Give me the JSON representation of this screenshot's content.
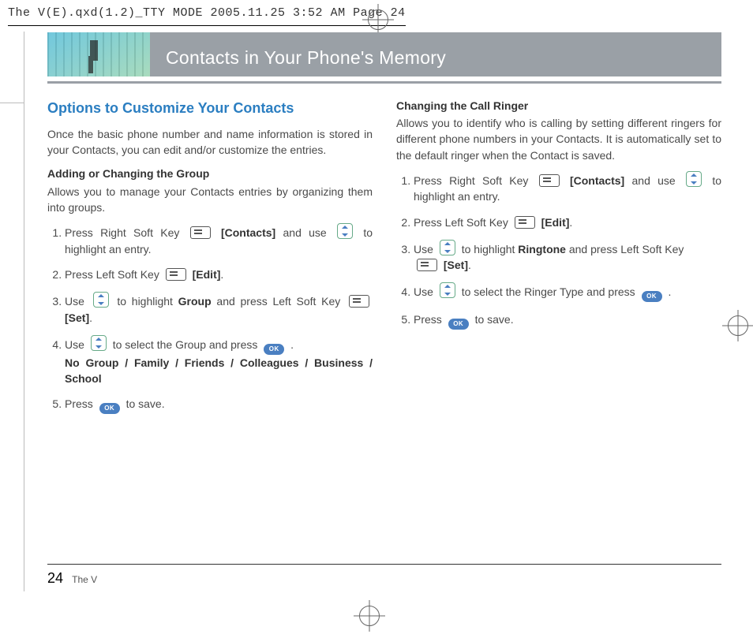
{
  "slug": "The V(E).qxd(1.2)_TTY MODE  2005.11.25  3:52 AM  Page 24",
  "header": {
    "title": "Contacts in Your Phone's Memory"
  },
  "left": {
    "section_title": "Options to Customize Your Contacts",
    "intro": "Once the basic phone number and name information is stored in your Contacts, you can edit and/or customize the entries.",
    "sub1_title": "Adding or Changing the Group",
    "sub1_lead": "Allows you to manage your Contacts entries by organizing them into groups.",
    "s1_a": "Press Right Soft Key",
    "s1_b": "[Contacts]",
    "s1_c": "and use",
    "s1_d": "to highlight an entry.",
    "s2_a": "Press Left Soft Key",
    "s2_b": "[Edit]",
    "s3_a": "Use",
    "s3_b": "to highlight",
    "s3_c": "Group",
    "s3_d": "and press Left Soft Key",
    "s3_e": "[Set]",
    "s4_a": "Use",
    "s4_b": "to select the Group and press",
    "s4_groups": "No Group / Family / Friends / Colleagues / Business / School",
    "s5_a": "Press",
    "s5_b": "to save."
  },
  "right": {
    "sub_title": "Changing the Call Ringer",
    "lead": "Allows you to identify who is calling by setting different ringers for different phone numbers in your Contacts. It is automatically set to the default ringer when the Contact is saved.",
    "r1_a": "Press Right Soft Key",
    "r1_b": "[Contacts]",
    "r1_c": "and use",
    "r1_d": "to highlight an entry.",
    "r2_a": "Press Left Soft Key",
    "r2_b": "[Edit]",
    "r3_a": "Use",
    "r3_b": "to highlight",
    "r3_c": "Ringtone",
    "r3_d": "and press Left Soft Key",
    "r3_e": "[Set]",
    "r4_a": "Use",
    "r4_b": "to select the Ringer Type and press",
    "r5_a": "Press",
    "r5_b": "to save."
  },
  "footer": {
    "page_number": "24",
    "doc_title": "The V"
  },
  "icons": {
    "ok_label": "OK"
  }
}
